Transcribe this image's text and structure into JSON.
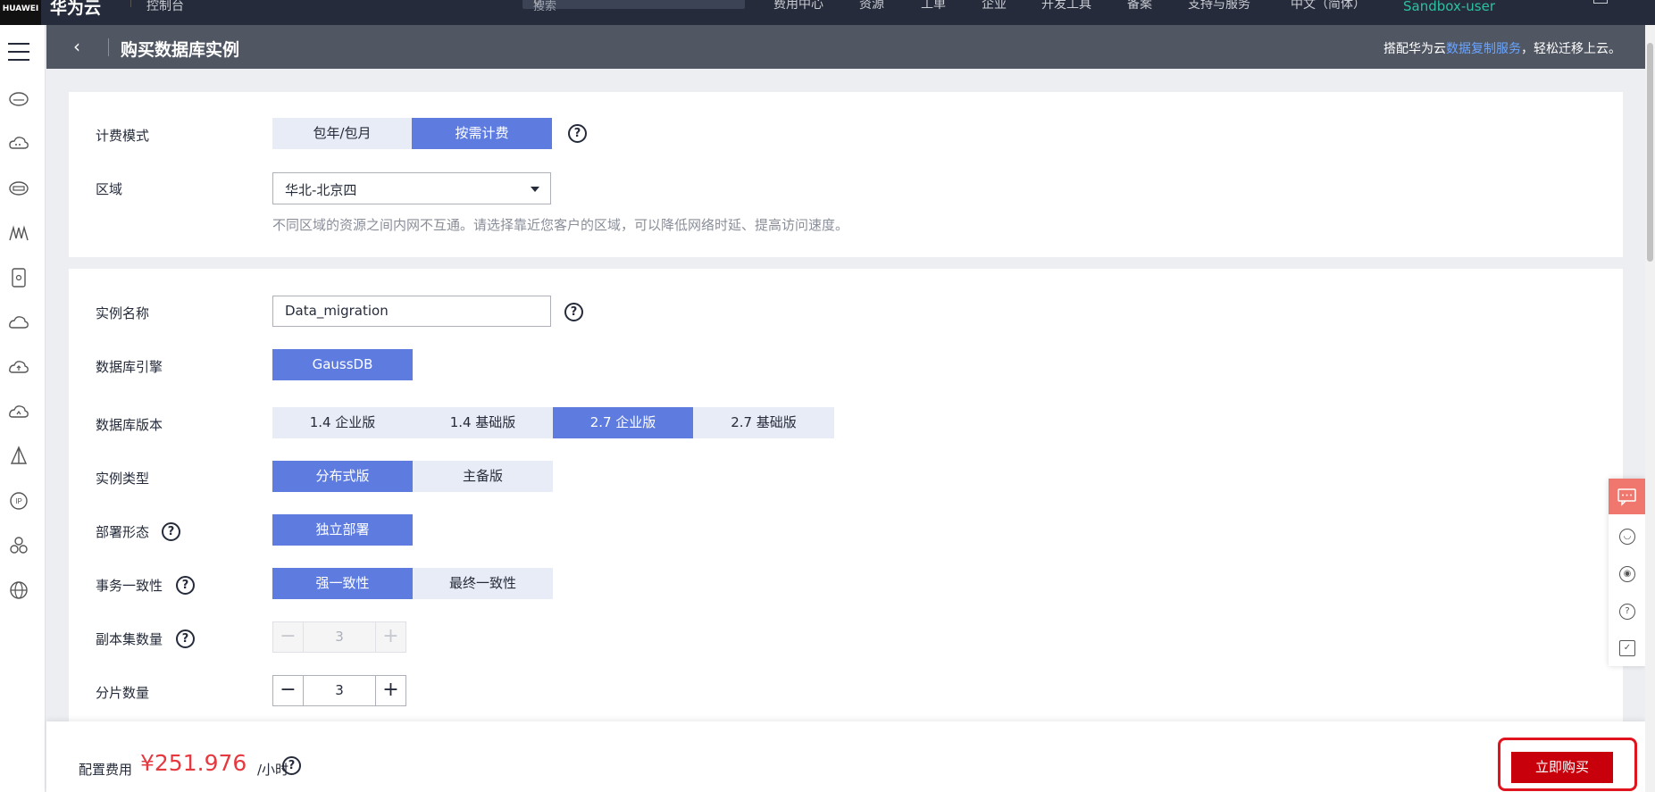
{
  "topnav": {
    "logo": "HUAWEI",
    "brand": "华为云",
    "console": "控制台",
    "search_placeholder": "搜索",
    "items": [
      "费用中心",
      "资源",
      "工单",
      "企业",
      "开发工具",
      "备案",
      "支持与服务",
      "中文（简体）"
    ],
    "user": "Sandbox-user"
  },
  "sidebar": {
    "icons": [
      "hamburger-icon",
      "cloud-server-icon",
      "cloud-icon",
      "storage-icon",
      "network-icon",
      "database-icon",
      "cloud-icon",
      "cloud-upload-icon",
      "cloud-sync-icon",
      "triangle-icon",
      "ip-icon",
      "cluster-icon",
      "globe-icon"
    ]
  },
  "header": {
    "back": "‹",
    "title": "购买数据库实例",
    "tip_prefix": "搭配华为云",
    "tip_link": "数据复制服务",
    "tip_suffix": "，轻松迁移上云。"
  },
  "form": {
    "billing": {
      "label": "计费模式",
      "options": [
        "包年/包月",
        "按需计费"
      ],
      "selected": 1
    },
    "region": {
      "label": "区域",
      "value": "华北-北京四",
      "hint": "不同区域的资源之间内网不互通。请选择靠近您客户的区域，可以降低网络时延、提高访问速度。"
    },
    "instance_name": {
      "label": "实例名称",
      "value": "Data_migration"
    },
    "engine": {
      "label": "数据库引擎",
      "options": [
        "GaussDB"
      ],
      "selected": 0
    },
    "version": {
      "label": "数据库版本",
      "options": [
        "1.4 企业版",
        "1.4 基础版",
        "2.7 企业版",
        "2.7 基础版"
      ],
      "selected": 2
    },
    "instance_type": {
      "label": "实例类型",
      "options": [
        "分布式版",
        "主备版"
      ],
      "selected": 0
    },
    "deploy": {
      "label": "部署形态",
      "options": [
        "独立部署"
      ],
      "selected": 0
    },
    "consistency": {
      "label": "事务一致性",
      "options": [
        "强一致性",
        "最终一致性"
      ],
      "selected": 0
    },
    "replicas": {
      "label": "副本集数量",
      "value": "3"
    },
    "shards": {
      "label": "分片数量",
      "value": "3"
    }
  },
  "footer": {
    "fee_label": "配置费用",
    "price": "¥251.976",
    "unit": "/小时",
    "buy": "立即购买"
  },
  "colors": {
    "primary": "#5e7ce0",
    "buy": "#c7000b",
    "price": "#e6393f",
    "header": "#505662",
    "topnav": "#252b3a"
  }
}
